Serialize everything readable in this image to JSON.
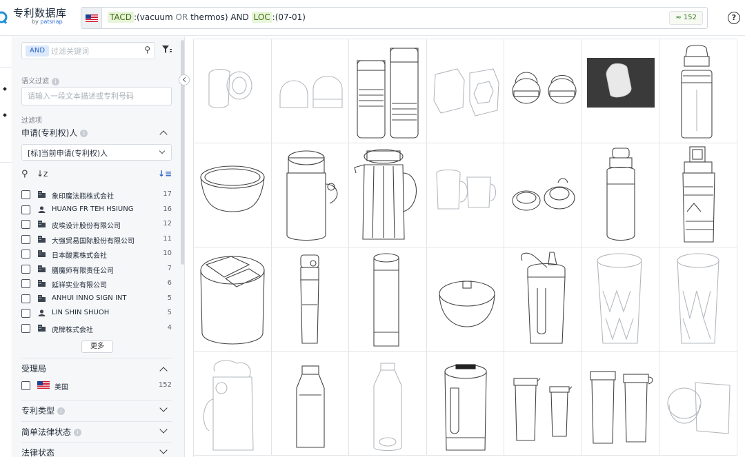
{
  "app": {
    "brand": "专利数据库",
    "brand_sub_prefix": "by",
    "brand_sub_name": "patsnap"
  },
  "search": {
    "field1": "TACD",
    "term_open": ":(vacuum ",
    "op_or": "OR",
    "term_close": " thermos) AND ",
    "field2": "LOC",
    "term2": ":(07-01)",
    "count_badge": "≈ 152",
    "help": "?"
  },
  "filters": {
    "and_label": "AND",
    "keyword_placeholder": "过滤关键词",
    "semantic_label": "语义过滤",
    "semantic_placeholder": "请输入一段文本描述或专利号码",
    "filter_section_label": "过滤项",
    "applicant_title": "申请(专利权)人",
    "applicant_select": "[标]当前申请(专利权)人",
    "applicants": [
      {
        "name": "象印魔法瓶株式会社",
        "count": "17",
        "type": "company"
      },
      {
        "name": "HUANG FR TEH HSIUNG",
        "count": "16",
        "type": "person"
      },
      {
        "name": "皮埃设计股份有限公司",
        "count": "12",
        "type": "company"
      },
      {
        "name": "大强贸易国际股份有限公司",
        "count": "11",
        "type": "company"
      },
      {
        "name": "日本酸素株式会社",
        "count": "10",
        "type": "company"
      },
      {
        "name": "膳魔师有限责任公司",
        "count": "7",
        "type": "company"
      },
      {
        "name": "延祥实业有限公司",
        "count": "6",
        "type": "company"
      },
      {
        "name": "ANHUI INNO SIGN INT",
        "count": "5",
        "type": "company"
      },
      {
        "name": "LIN SHIN SHUOH",
        "count": "5",
        "type": "person"
      },
      {
        "name": "虎牌株式会社",
        "count": "4",
        "type": "company"
      }
    ],
    "more_label": "更多",
    "office_title": "受理局",
    "office": {
      "name": "美国",
      "count": "152"
    },
    "patent_type_title": "专利类型",
    "simple_status_title": "简单法律状态",
    "legal_status_title": "法律状态"
  }
}
